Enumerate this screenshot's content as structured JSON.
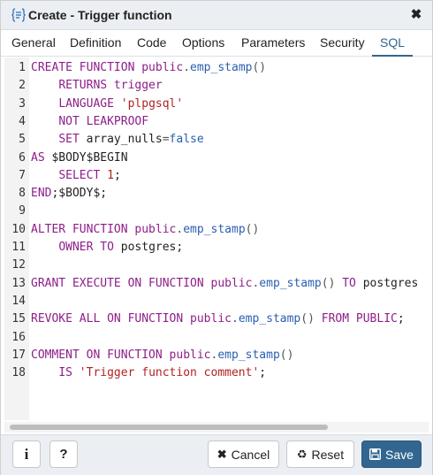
{
  "dialog": {
    "title": "Create - Trigger function",
    "close_icon": "close-icon",
    "title_icon": "trigger-function-icon"
  },
  "tabs": [
    {
      "label": "General",
      "active": false
    },
    {
      "label": "Definition",
      "active": false
    },
    {
      "label": "Code",
      "active": false
    },
    {
      "label": "Options",
      "active": false
    },
    {
      "label": "Parameters",
      "active": false
    },
    {
      "label": "Security",
      "active": false
    },
    {
      "label": "SQL",
      "active": true
    }
  ],
  "sql": {
    "lines": [
      {
        "n": "1",
        "tokens": [
          [
            "kw",
            "CREATE FUNCTION "
          ],
          [
            "kw",
            "public"
          ],
          [
            "pun",
            "."
          ],
          [
            "fn",
            "emp_stamp"
          ],
          [
            "pun",
            "()"
          ]
        ]
      },
      {
        "n": "2",
        "tokens": [
          [
            "txt",
            "    "
          ],
          [
            "kw",
            "RETURNS trigger"
          ]
        ]
      },
      {
        "n": "3",
        "tokens": [
          [
            "txt",
            "    "
          ],
          [
            "kw",
            "LANGUAGE "
          ],
          [
            "str",
            "'plpgsql'"
          ]
        ]
      },
      {
        "n": "4",
        "tokens": [
          [
            "txt",
            "    "
          ],
          [
            "kw",
            "NOT LEAKPROOF"
          ]
        ]
      },
      {
        "n": "5",
        "tokens": [
          [
            "txt",
            "    "
          ],
          [
            "kw",
            "SET "
          ],
          [
            "txt",
            "array_nulls"
          ],
          [
            "pun",
            "="
          ],
          [
            "fn",
            "false"
          ]
        ]
      },
      {
        "n": "6",
        "tokens": [
          [
            "kw",
            "AS "
          ],
          [
            "txt",
            "$BODY$BEGIN"
          ]
        ]
      },
      {
        "n": "7",
        "tokens": [
          [
            "txt",
            "    "
          ],
          [
            "kw",
            "SELECT "
          ],
          [
            "str",
            "1"
          ],
          [
            "txt",
            ";"
          ]
        ]
      },
      {
        "n": "8",
        "tokens": [
          [
            "kw",
            "END"
          ],
          [
            "txt",
            ";$BODY$;"
          ]
        ]
      },
      {
        "n": "9",
        "tokens": []
      },
      {
        "n": "10",
        "tokens": [
          [
            "kw",
            "ALTER FUNCTION "
          ],
          [
            "kw",
            "public"
          ],
          [
            "pun",
            "."
          ],
          [
            "fn",
            "emp_stamp"
          ],
          [
            "pun",
            "()"
          ]
        ]
      },
      {
        "n": "11",
        "tokens": [
          [
            "txt",
            "    "
          ],
          [
            "kw",
            "OWNER TO "
          ],
          [
            "txt",
            "postgres;"
          ]
        ]
      },
      {
        "n": "12",
        "tokens": []
      },
      {
        "n": "13",
        "tokens": [
          [
            "kw",
            "GRANT EXECUTE ON FUNCTION "
          ],
          [
            "kw",
            "public"
          ],
          [
            "pun",
            "."
          ],
          [
            "fn",
            "emp_stamp"
          ],
          [
            "pun",
            "() "
          ],
          [
            "kw",
            "TO "
          ],
          [
            "txt",
            "postgres"
          ]
        ]
      },
      {
        "n": "14",
        "tokens": []
      },
      {
        "n": "15",
        "tokens": [
          [
            "kw",
            "REVOKE ALL ON FUNCTION "
          ],
          [
            "kw",
            "public"
          ],
          [
            "pun",
            "."
          ],
          [
            "fn",
            "emp_stamp"
          ],
          [
            "pun",
            "() "
          ],
          [
            "kw",
            "FROM PUBLIC"
          ],
          [
            "txt",
            ";"
          ]
        ]
      },
      {
        "n": "16",
        "tokens": []
      },
      {
        "n": "17",
        "tokens": [
          [
            "kw",
            "COMMENT ON FUNCTION "
          ],
          [
            "kw",
            "public"
          ],
          [
            "pun",
            "."
          ],
          [
            "fn",
            "emp_stamp"
          ],
          [
            "pun",
            "()"
          ]
        ]
      },
      {
        "n": "18",
        "tokens": [
          [
            "txt",
            "    "
          ],
          [
            "kw",
            "IS "
          ],
          [
            "str",
            "'Trigger function comment'"
          ],
          [
            "txt",
            ";"
          ]
        ]
      }
    ]
  },
  "footer": {
    "info_label": "i",
    "help_label": "?",
    "cancel_label": "Cancel",
    "reset_label": "Reset",
    "save_label": "Save"
  },
  "colors": {
    "keyword": "#8e1e8a",
    "function": "#2a5fb0",
    "string": "#b22222",
    "accent": "#326690"
  }
}
